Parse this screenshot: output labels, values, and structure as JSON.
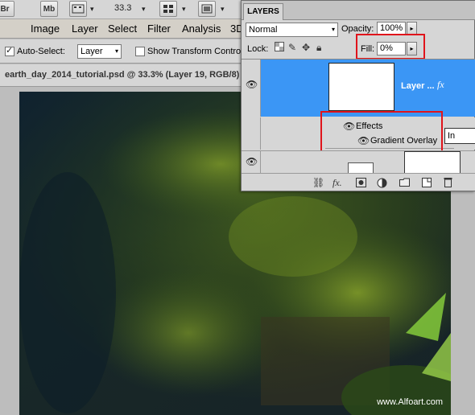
{
  "appbar": {
    "br_label": "Br",
    "mb_label": "Mb",
    "zoom_value": "33.3",
    "dropdown_arrow": "▾"
  },
  "menu": {
    "items": [
      "Image",
      "Layer",
      "Select",
      "Filter",
      "Analysis",
      "3D"
    ]
  },
  "options": {
    "auto_select_label": "Auto-Select:",
    "auto_select_value": "Layer",
    "show_transform_label": "Show Transform Controls",
    "auto_select_checked": true,
    "show_transform_checked": false
  },
  "document": {
    "title": "earth_day_2014_tutorial.psd @ 33.3% (Layer 19, RGB/8)"
  },
  "layers_panel": {
    "tab_label": "LAYERS",
    "blend_mode": "Normal",
    "opacity_label": "Opacity:",
    "opacity_value": "100%",
    "lock_label": "Lock:",
    "fill_label": "Fill:",
    "fill_value": "0%",
    "layer_name": "Layer ...",
    "fx_label": "fx",
    "effects_label": "Effects",
    "gradient_overlay_label": "Gradient Overlay",
    "tooltip_text": "In",
    "stepper_glyph": "▸"
  },
  "icons": {
    "eye": "eye-icon",
    "link": "link-icon",
    "fx": "fx-icon",
    "mask": "mask-icon",
    "adjustment": "adjustment-icon",
    "folder": "folder-icon",
    "new_layer": "new-layer-icon",
    "trash": "trash-icon"
  },
  "canvas": {
    "watermark": "www.Alfoart.com"
  },
  "colors": {
    "selection_blue": "#3b96f5",
    "highlight_red": "#e0141b"
  }
}
